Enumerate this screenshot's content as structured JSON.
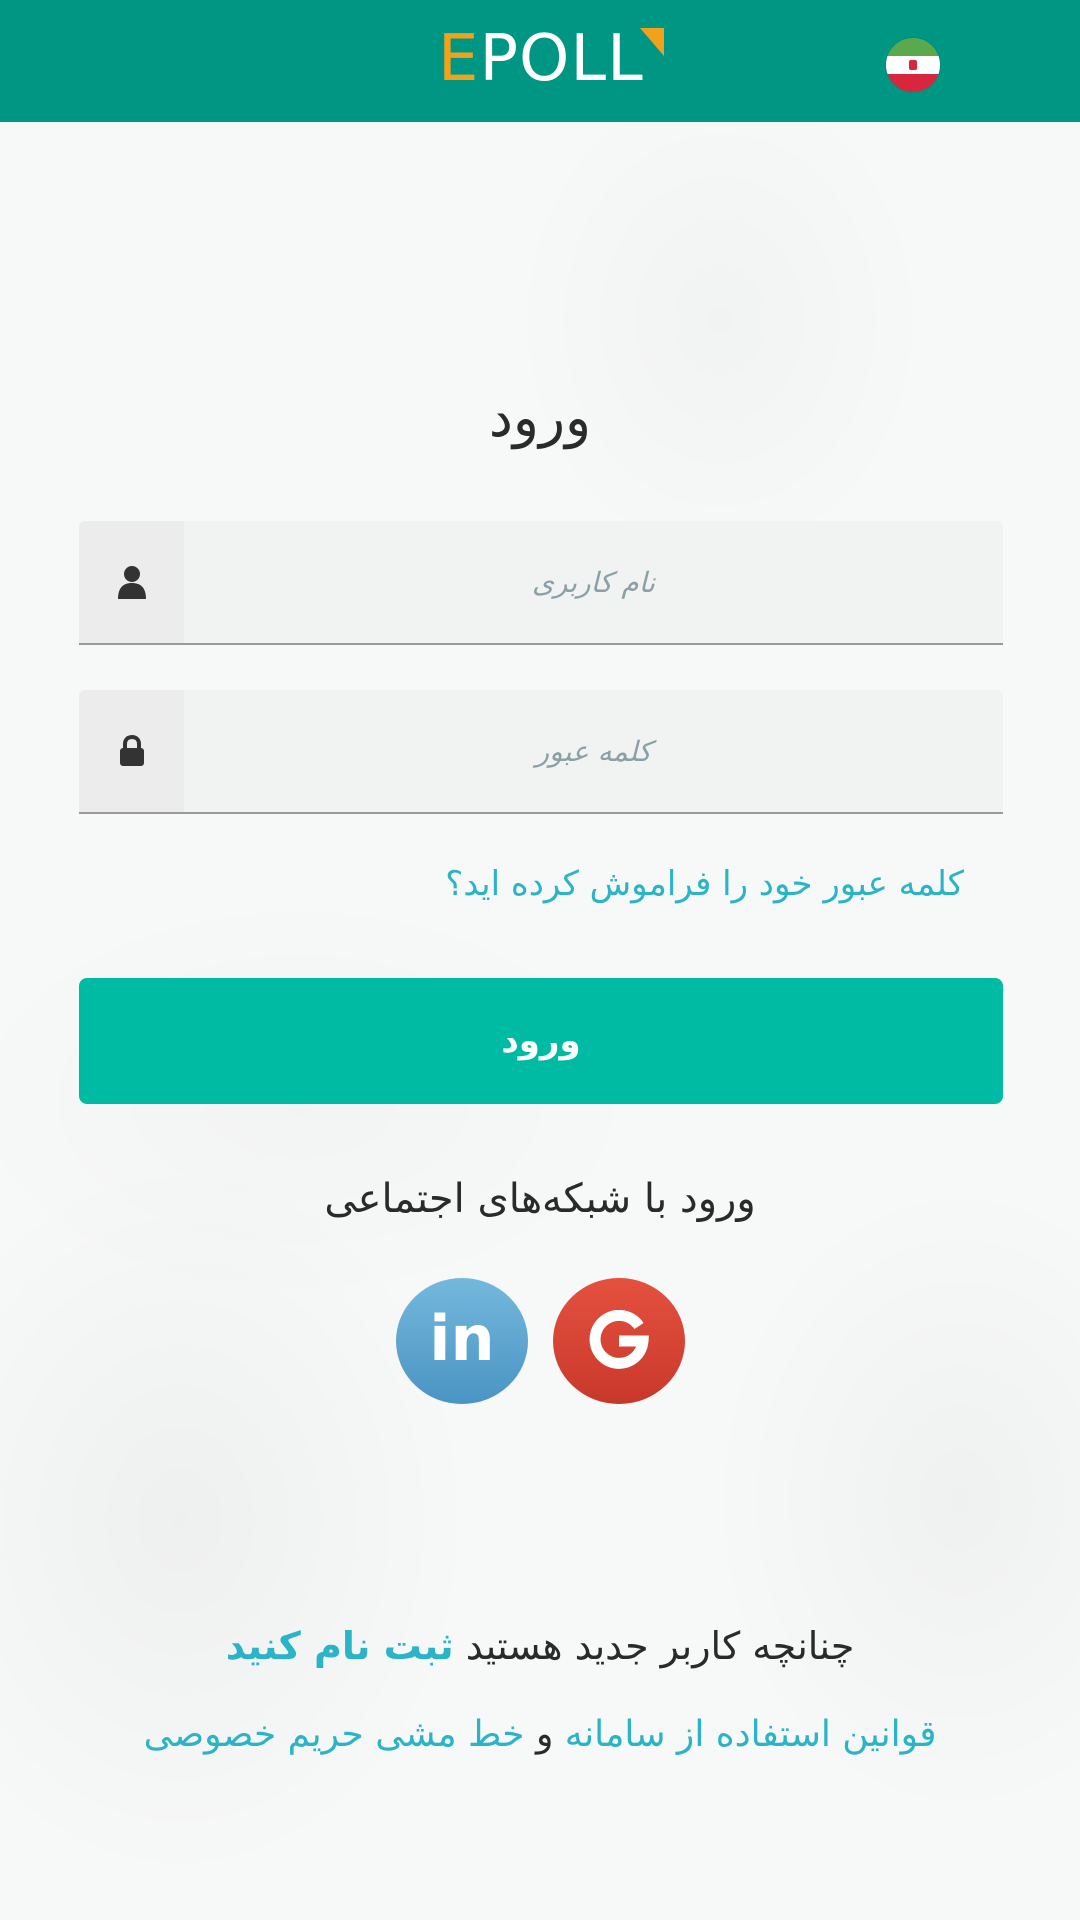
{
  "header": {
    "logo_e": "E",
    "logo_rest": "POLL",
    "language_flag": "iran-flag-icon",
    "brand_color": "#009684",
    "logo_accent_color": "#f2a21a"
  },
  "login": {
    "title": "ورود",
    "username_placeholder": "نام کاربری",
    "password_placeholder": "کلمه عبور",
    "username_icon": "user-icon",
    "password_icon": "lock-icon",
    "forgot_password": "کلمه عبور خود را فراموش کرده اید؟",
    "submit_label": "ورود",
    "submit_color": "#00bba3"
  },
  "social": {
    "title": "ورود با شبکه‌های اجتماعی",
    "linkedin_label": "in",
    "linkedin_icon": "linkedin-icon",
    "google_icon": "google-icon"
  },
  "footer": {
    "register_prefix": "چنانچه کاربر جدید هستید",
    "register_link": "ثبت نام کنید",
    "terms_link": "قوانین استفاده از سامانه",
    "terms_and": "و",
    "privacy_link": "خط مشی حریم خصوصی",
    "link_color": "#2bb3c8"
  }
}
